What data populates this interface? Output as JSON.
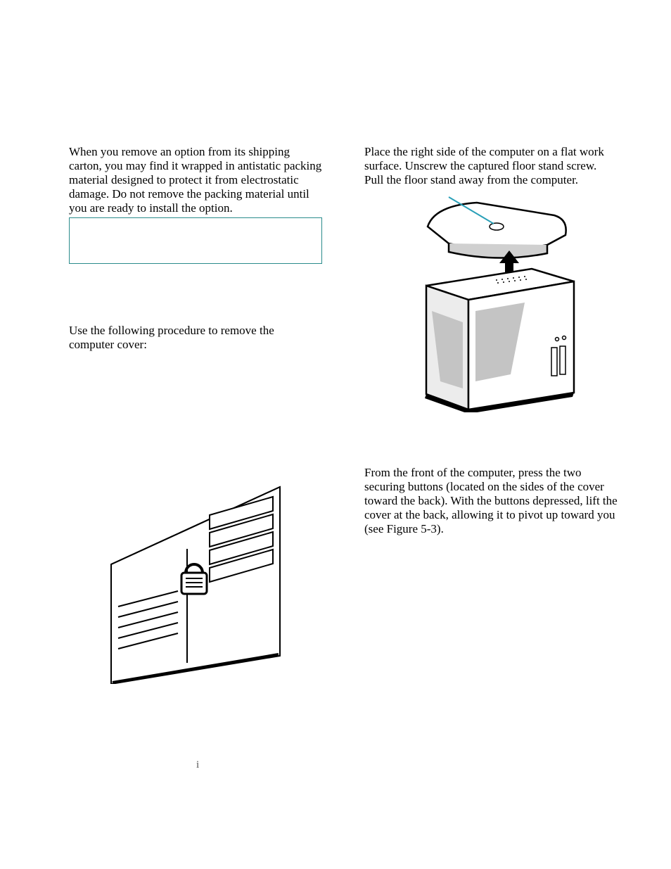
{
  "left": {
    "para1": "When you remove an option from its shipping carton, you may find it wrapped in antistatic packing material designed to protect it from electrostatic damage. Do not remove the packing material until you are ready to install the option.",
    "para2": "Use the following procedure to remove the computer cover:"
  },
  "right": {
    "para1": "Place the right side of the computer on a flat work surface. Unscrew the captured floor stand screw. Pull the floor stand away from the computer.",
    "para2": "From the front of the computer, press the two securing buttons (located on the sides of the cover toward the back). With the buttons depressed, lift the cover at the back, allowing it to pivot up toward you (see Figure 5-3)."
  },
  "page_marker": "i",
  "figures": {
    "fig1_alt": "padlock-on-computer-back-illustration",
    "fig2_alt": "remove-floor-stand-illustration"
  }
}
